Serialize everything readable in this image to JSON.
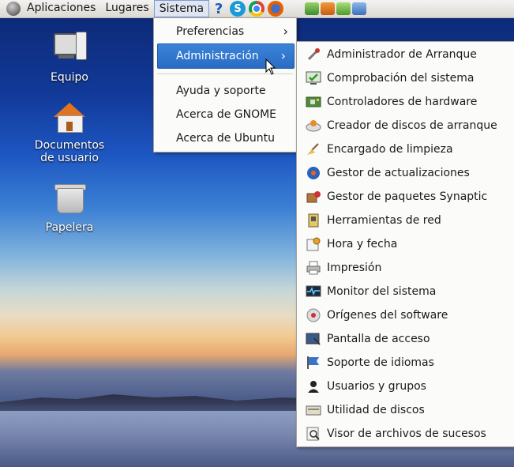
{
  "panel": {
    "menus": [
      "Aplicaciones",
      "Lugares",
      "Sistema"
    ],
    "help_glyph": "?"
  },
  "desktop": {
    "icons": [
      {
        "label": "Equipo",
        "icon": "computer-icon"
      },
      {
        "label": "Documentos de usuario",
        "icon": "home-folder-icon"
      },
      {
        "label": "Papelera",
        "icon": "trash-icon"
      }
    ]
  },
  "sistema_menu": {
    "items": [
      {
        "label": "Preferencias",
        "submenu": true
      },
      {
        "label": "Administración",
        "submenu": true,
        "selected": true
      },
      {
        "label": "Ayuda y soporte"
      },
      {
        "label": "Acerca de GNOME"
      },
      {
        "label": "Acerca de Ubuntu"
      }
    ]
  },
  "admin_menu": {
    "items": [
      {
        "label": "Administrador de Arranque",
        "icon": "wrench-icon"
      },
      {
        "label": "Comprobación del sistema",
        "icon": "monitor-check-icon"
      },
      {
        "label": "Controladores de hardware",
        "icon": "chip-icon"
      },
      {
        "label": "Creador de discos de arranque",
        "icon": "disc-icon"
      },
      {
        "label": "Encargado de limpieza",
        "icon": "broom-icon"
      },
      {
        "label": "Gestor de actualizaciones",
        "icon": "update-icon"
      },
      {
        "label": "Gestor de paquetes Synaptic",
        "icon": "package-icon"
      },
      {
        "label": "Herramientas de red",
        "icon": "network-icon"
      },
      {
        "label": "Hora y fecha",
        "icon": "clock-icon"
      },
      {
        "label": "Impresión",
        "icon": "printer-icon"
      },
      {
        "label": "Monitor del sistema",
        "icon": "system-monitor-icon"
      },
      {
        "label": "Orígenes del software",
        "icon": "software-sources-icon"
      },
      {
        "label": "Pantalla de acceso",
        "icon": "login-screen-icon"
      },
      {
        "label": "Soporte de idiomas",
        "icon": "language-flag-icon"
      },
      {
        "label": "Usuarios y grupos",
        "icon": "users-icon"
      },
      {
        "label": "Utilidad de discos",
        "icon": "disk-utility-icon"
      },
      {
        "label": "Visor de archivos de sucesos",
        "icon": "log-viewer-icon"
      }
    ]
  },
  "colors": {
    "selection": "#2a6cc4",
    "panel_bg": "#e6e3de",
    "menu_bg": "#fbfbfa"
  }
}
